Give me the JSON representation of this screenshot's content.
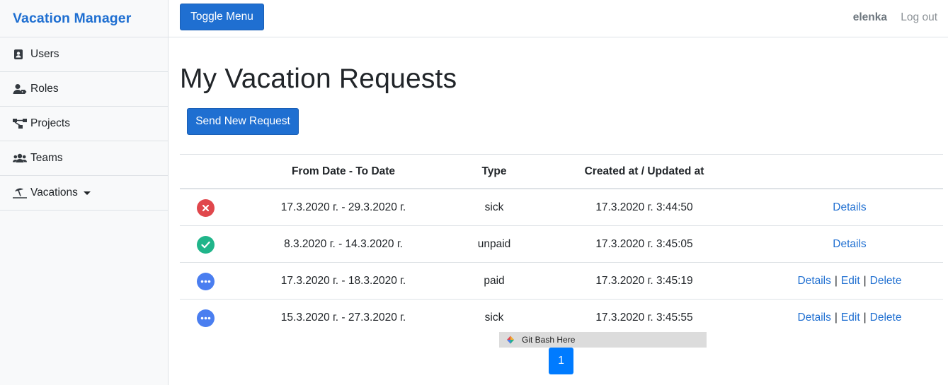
{
  "sidebar": {
    "brand": "Vacation Manager",
    "items": [
      {
        "label": "Users",
        "icon": "address-book-icon"
      },
      {
        "label": "Roles",
        "icon": "user-tag-icon"
      },
      {
        "label": "Projects",
        "icon": "project-diagram-icon"
      },
      {
        "label": "Teams",
        "icon": "users-icon"
      },
      {
        "label": "Vacations",
        "icon": "umbrella-beach-icon"
      }
    ]
  },
  "topbar": {
    "toggle_label": "Toggle Menu",
    "username": "elenka",
    "logout_label": "Log out"
  },
  "main": {
    "title": "My Vacation Requests",
    "send_label": "Send New Request",
    "table": {
      "headers": [
        "",
        "From Date - To Date",
        "Type",
        "Created at / Updated at",
        ""
      ],
      "rows": [
        {
          "status": "rejected",
          "status_color": "#e0474c",
          "dates": "17.3.2020 г. - 29.3.2020 г.",
          "type": "sick",
          "created": "17.3.2020 г. 3:44:50",
          "details": "Details",
          "edit": "",
          "delete": ""
        },
        {
          "status": "approved",
          "status_color": "#20b58a",
          "dates": "8.3.2020 г. - 14.3.2020 г.",
          "type": "unpaid",
          "created": "17.3.2020 г. 3:45:05",
          "details": "Details",
          "edit": "",
          "delete": ""
        },
        {
          "status": "pending",
          "status_color": "#4a7ef0",
          "dates": "17.3.2020 г. - 18.3.2020 г.",
          "type": "paid",
          "created": "17.3.2020 г. 3:45:19",
          "details": "Details",
          "edit": "Edit",
          "delete": "Delete"
        },
        {
          "status": "pending",
          "status_color": "#4a7ef0",
          "dates": "15.3.2020 г. - 27.3.2020 г.",
          "type": "sick",
          "created": "17.3.2020 г. 3:45:55",
          "details": "Details",
          "edit": "Edit",
          "delete": "Delete"
        }
      ]
    },
    "pagination": {
      "current": "1"
    }
  },
  "tooltip": {
    "label": "Git Bash Here"
  },
  "colors": {
    "primary": "#1f6fd1",
    "page_active": "#007bff"
  }
}
